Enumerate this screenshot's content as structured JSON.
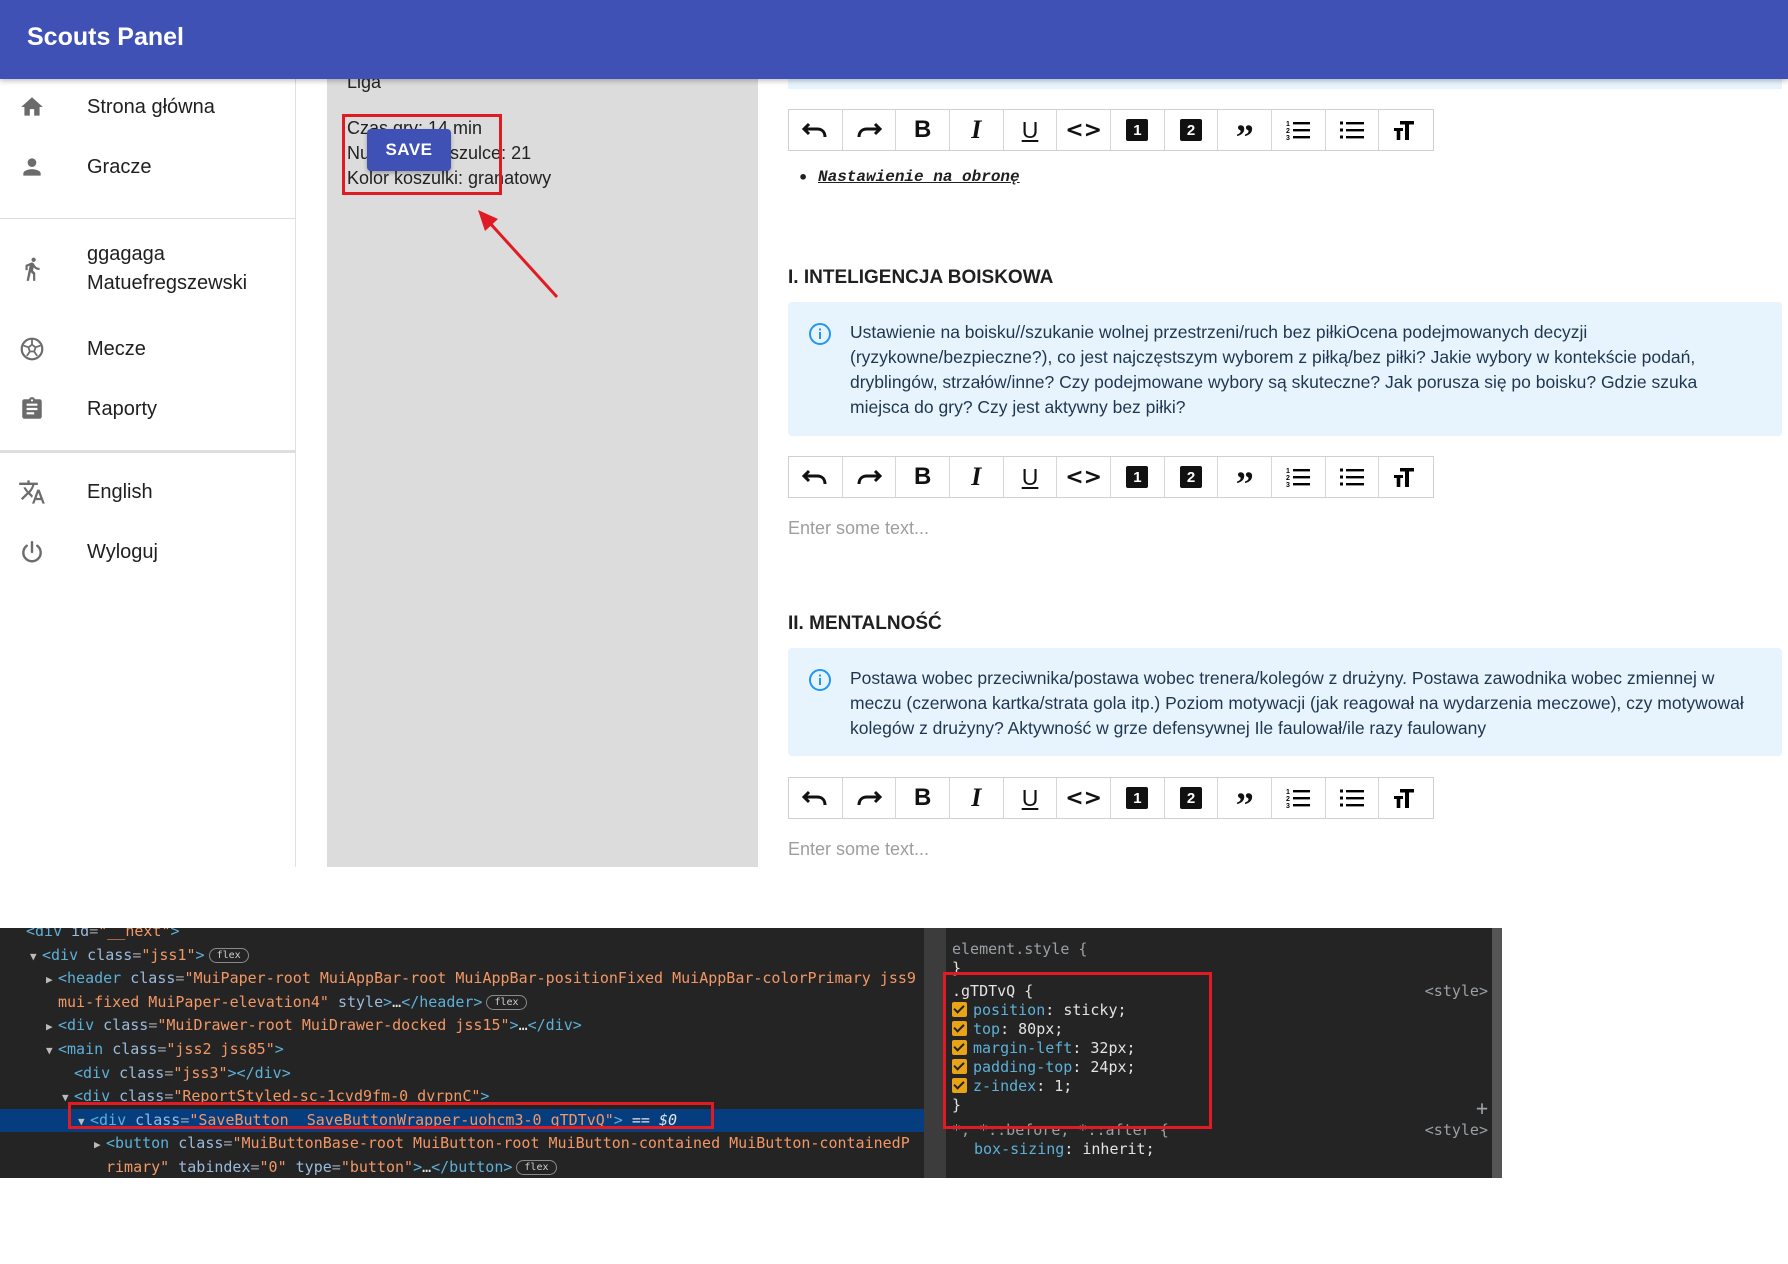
{
  "app": {
    "title": "Scouts Panel"
  },
  "sidebar": {
    "items": [
      {
        "label": "Strona główna",
        "icon": "home-icon"
      },
      {
        "label": "Gracze",
        "icon": "person-icon"
      },
      {
        "label": "ggagaga\nMatuefregszewski",
        "icon": "runner-icon"
      },
      {
        "label": "Mecze",
        "icon": "soccer-ball-icon"
      },
      {
        "label": "Raporty",
        "icon": "clipboard-icon"
      },
      {
        "label": "English",
        "icon": "translate-icon"
      },
      {
        "label": "Wyloguj",
        "icon": "power-icon"
      }
    ]
  },
  "match_info": {
    "league": "Liga",
    "play_time": "Czas gry: 14 min",
    "shirt_number": "Numer na koszulce: 21",
    "shirt_color": "Kolor koszulki: granatowy",
    "save_label": "SAVE"
  },
  "editor": {
    "toolbar_icons": [
      "undo-icon",
      "redo-icon",
      "bold-icon",
      "italic-icon",
      "underline-icon",
      "code-icon",
      "heading-one-icon",
      "heading-two-icon",
      "blockquote-icon",
      "numbered-list-icon",
      "bulleted-list-icon",
      "text-size-icon"
    ],
    "toolbar_glyphs": {
      "b": "B",
      "i": "I",
      "u": "U",
      "code": "<>",
      "h1": "1",
      "h2": "2",
      "quote": "”"
    },
    "bullet_text": "Nastawienie na obronę",
    "placeholder": "Enter some text...",
    "sections": [
      {
        "title": "I. INTELIGENCJA BOISKOWA",
        "info": "Ustawienie na boisku//szukanie wolnej przestrzeni/ruch bez piłkiOcena podejmowanych decyzji (ryzykowne/bezpieczne?), co jest najczęstszym wyborem z piłką/bez piłki? Jakie wybory w kontekście podań, dryblingów, strzałów/inne? Czy podejmowane wybory są skuteczne? Jak porusza się po boisku? Gdzie szuka miejsca do gry? Czy jest aktywny bez piłki?"
      },
      {
        "title": "II. MENTALNOŚĆ",
        "info": "Postawa wobec przeciwnika/postawa wobec trenera/kolegów z drużyny. Postawa zawodnika wobec zmiennej w meczu (czerwona kartka/strata gola itp.) Poziom motywacji (jak reagował na wydarzenia meczowe), czy motywował kolegów z drużyny? Aktywność w grze defensywnej Ile faulował/ile razy faulowany"
      }
    ]
  },
  "devtools": {
    "dom_lines": [
      {
        "indent": 0,
        "arrow": "",
        "html": "<span class='tag'>&lt;div</span> <span class='an'>id</span>=<span class='av'>\"__next\"</span><span class='tag'>&gt;</span>"
      },
      {
        "indent": 1,
        "arrow": "▼",
        "html": "<span class='tag'>&lt;div</span> <span class='an'>class</span>=<span class='av'>\"jss1\"</span><span class='tag'>&gt;</span><span class='badge'>flex</span>"
      },
      {
        "indent": 2,
        "arrow": "▶",
        "html": "<span class='tag'>&lt;header</span> <span class='an'>class</span>=<span class='av'>\"MuiPaper-root MuiAppBar-root MuiAppBar-positionFixed MuiAppBar-colorPrimary jss9</span>"
      },
      {
        "indent": 2,
        "arrow": "",
        "html": "<span class='av'>mui-fixed MuiPaper-elevation4\"</span> <span class='an'>style</span><span class='tag'>&gt;</span><span class='tx'>…</span><span class='tag'>&lt;/header&gt;</span><span class='badge'>flex</span>"
      },
      {
        "indent": 2,
        "arrow": "▶",
        "html": "<span class='tag'>&lt;div</span> <span class='an'>class</span>=<span class='av'>\"MuiDrawer-root MuiDrawer-docked jss15\"</span><span class='tag'>&gt;</span><span class='tx'>…</span><span class='tag'>&lt;/div&gt;</span>"
      },
      {
        "indent": 2,
        "arrow": "▼",
        "html": "<span class='tag'>&lt;main</span> <span class='an'>class</span>=<span class='av'>\"jss2 jss85\"</span><span class='tag'>&gt;</span>"
      },
      {
        "indent": 3,
        "arrow": "",
        "html": "<span class='tag'>&lt;div</span> <span class='an'>class</span>=<span class='av'>\"jss3\"</span><span class='tag'>&gt;&lt;/div&gt;</span>"
      },
      {
        "indent": 3,
        "arrow": "▼",
        "html": "<span class='tag'>&lt;div</span> <span class='an'>class</span>=<span class='av'>\"ReportStyled-sc-1cvd9fm-0 dvrpnC\"</span><span class='tag'>&gt;</span>"
      },
      {
        "indent": 4,
        "arrow": "▼",
        "html": "<span class='tag'>&lt;div</span> <span class='an'>class</span>=<span class='av'>\"SaveButton__SaveButtonWrapper-uohcm3-0 gTDTvQ\"</span><span class='tag'>&gt;</span> <span class='tx'>== <i>$0</i></span>",
        "selected": true
      },
      {
        "indent": 5,
        "arrow": "▶",
        "html": "<span class='tag'>&lt;button</span> <span class='an'>class</span>=<span class='av'>\"MuiButtonBase-root MuiButton-root MuiButton-contained MuiButton-containedP</span>"
      },
      {
        "indent": 5,
        "arrow": "",
        "html": "<span class='av'>rimary\"</span> <span class='an'>tabindex</span>=<span class='av'>\"0\"</span> <span class='an'>type</span>=<span class='av'>\"button\"</span><span class='tag'>&gt;</span><span class='tx'>…</span><span class='tag'>&lt;/button&gt;</span><span class='badge'>flex</span>"
      }
    ],
    "styles": {
      "element_style": "element.style {",
      "close": "}",
      "rule_selector": ".gTDTvQ {",
      "rule_source": "<style>",
      "props": [
        {
          "name": "position",
          "value": "sticky;"
        },
        {
          "name": "top",
          "value": "80px;"
        },
        {
          "name": "margin-left",
          "value": "32px;"
        },
        {
          "name": "padding-top",
          "value": "24px;"
        },
        {
          "name": "z-index",
          "value": "1;"
        }
      ],
      "plus": "+",
      "universal_selector": "*, *::before, *::after {",
      "universal_prop": {
        "name": "box-sizing",
        "value": "inherit;"
      }
    }
  }
}
